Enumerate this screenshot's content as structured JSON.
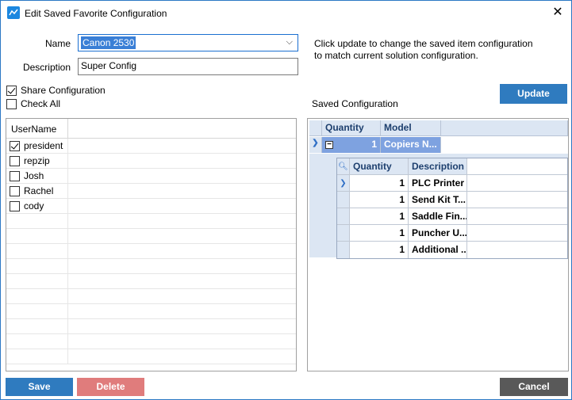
{
  "window": {
    "title": "Edit Saved Favorite Configuration"
  },
  "form": {
    "name_label": "Name",
    "name_value": "Canon 2530",
    "description_label": "Description",
    "description_value": "Super Config"
  },
  "info_text_line1": "Click update to change the saved item configuration",
  "info_text_line2": "to match current solution configuration.",
  "share_configuration": {
    "label": "Share Configuration",
    "checked": true
  },
  "check_all": {
    "label": "Check All",
    "checked": false
  },
  "buttons": {
    "update": "Update",
    "save": "Save",
    "delete": "Delete",
    "cancel": "Cancel"
  },
  "users": {
    "column_header": "UserName",
    "rows": [
      {
        "name": "president",
        "checked": true
      },
      {
        "name": "repzip",
        "checked": false
      },
      {
        "name": "Josh",
        "checked": false
      },
      {
        "name": "Rachel",
        "checked": false
      },
      {
        "name": "cody",
        "checked": false
      }
    ]
  },
  "saved_config": {
    "label": "Saved Configuration",
    "headers": {
      "quantity": "Quantity",
      "model": "Model"
    },
    "row": {
      "quantity": "1",
      "model": "Copiers N..."
    },
    "sub_headers": {
      "quantity": "Quantity",
      "description": "Description"
    },
    "sub_rows": [
      {
        "quantity": "1",
        "description": "PLC Printer"
      },
      {
        "quantity": "1",
        "description": "Send Kit T..."
      },
      {
        "quantity": "1",
        "description": "Saddle Fin..."
      },
      {
        "quantity": "1",
        "description": "Puncher U..."
      },
      {
        "quantity": "1",
        "description": "Additional ..."
      }
    ]
  },
  "colors": {
    "accent_blue": "#2f7bbf",
    "delete_red": "#e07c7c",
    "cancel_gray": "#595959",
    "grid_selected": "#7ea2e0"
  }
}
